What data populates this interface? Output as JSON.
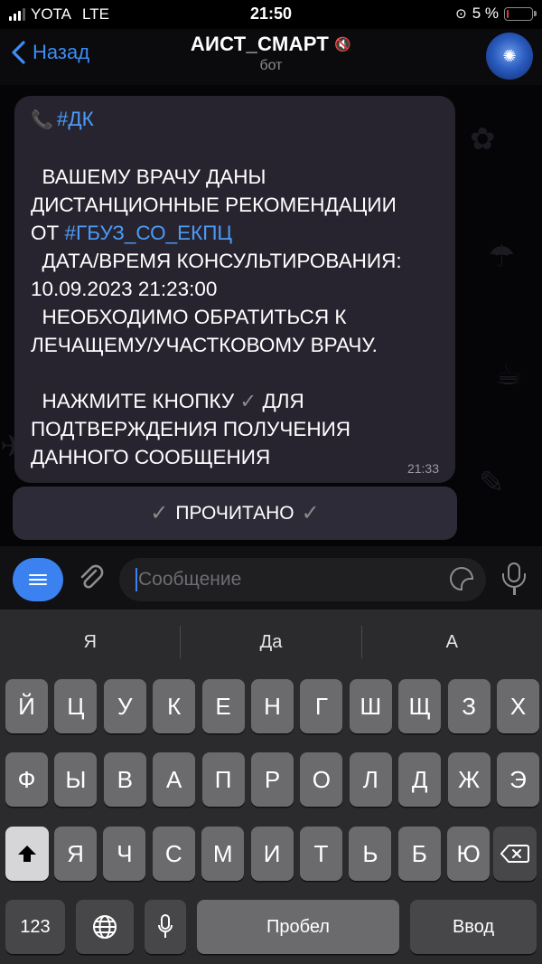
{
  "status_bar": {
    "carrier": "YOTA",
    "network": "LTE",
    "time": "21:50",
    "battery": "5 %",
    "battery_level_percent": 5
  },
  "header": {
    "back_label": "Назад",
    "title": "АИСТ_СМАРТ",
    "subtitle": "бот"
  },
  "message": {
    "hashtag_top": "#ДК",
    "line_1": "  ВАШЕМУ ВРАЧУ ДАНЫ",
    "line_2": "ДИСТАНЦИОННЫЕ РЕКОМЕНДАЦИИ",
    "line_3_prefix": "ОТ ",
    "line_3_hashtag": "#ГБУЗ_СО_ЕКПЦ",
    "line_4": "  ДАТА/ВРЕМЯ КОНСУЛЬТИРОВАНИЯ:",
    "line_5": "10.09.2023 21:23:00",
    "line_6": "  НЕОБХОДИМО ОБРАТИТЬСЯ К",
    "line_7": "ЛЕЧАЩЕМУ/УЧАСТКОВОМУ ВРАЧУ.",
    "line_8_prefix": "  НАЖМИТЕ КНОПКУ ",
    "line_8_suffix": " ДЛЯ",
    "line_9": "ПОДТВЕРЖДЕНИЯ ПОЛУЧЕНИЯ",
    "line_10": "ДАННОГО СООБЩЕНИЯ",
    "check_glyph": "✓",
    "time": "21:33"
  },
  "inline_button": {
    "label": "ПРОЧИТАНО",
    "check_glyph": "✓"
  },
  "composer": {
    "placeholder": "Сообщение"
  },
  "keyboard": {
    "suggestions": [
      "Я",
      "Да",
      "А"
    ],
    "row1": [
      "Й",
      "Ц",
      "У",
      "К",
      "Е",
      "Н",
      "Г",
      "Ш",
      "Щ",
      "З",
      "Х"
    ],
    "row2": [
      "Ф",
      "Ы",
      "В",
      "А",
      "П",
      "Р",
      "О",
      "Л",
      "Д",
      "Ж",
      "Э"
    ],
    "row3": [
      "Я",
      "Ч",
      "С",
      "М",
      "И",
      "Т",
      "Ь",
      "Б",
      "Ю"
    ],
    "numbers_label": "123",
    "space_label": "Пробел",
    "return_label": "Ввод"
  }
}
